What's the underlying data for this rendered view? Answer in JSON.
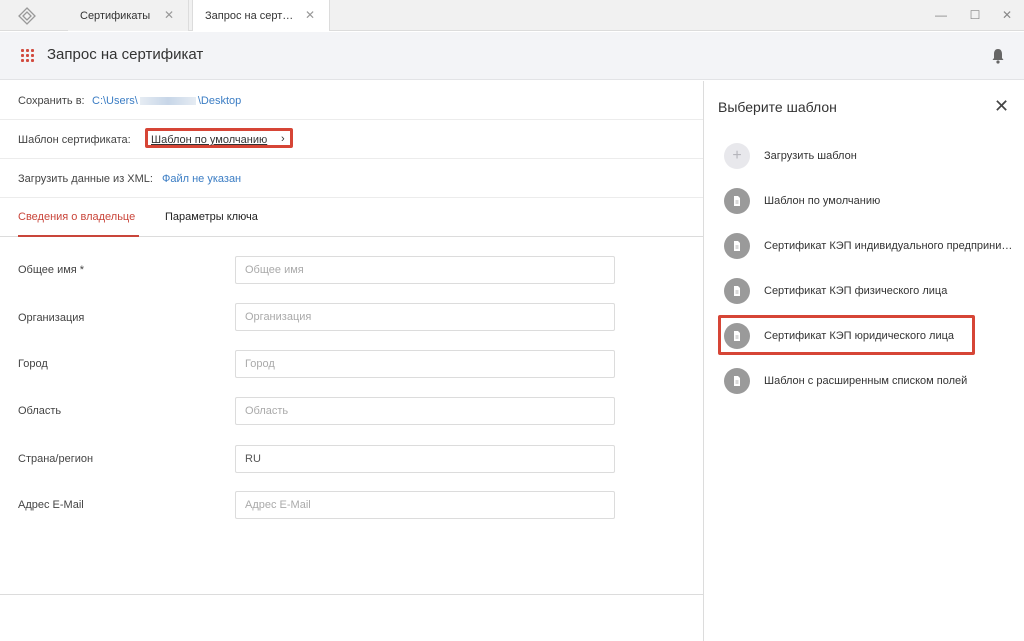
{
  "tabs": [
    {
      "label": "Сертификаты"
    },
    {
      "label": "Запрос на сертификат"
    }
  ],
  "header": {
    "title": "Запрос на сертификат"
  },
  "save_row": {
    "label": "Сохранить в:",
    "path_prefix": "C:\\Users\\",
    "path_suffix": "\\Desktop"
  },
  "template_row": {
    "label": "Шаблон сертификата:",
    "value": "Шаблон по умолчанию"
  },
  "xml_row": {
    "label": "Загрузить данные из XML:",
    "value": "Файл не указан"
  },
  "form_tabs": [
    {
      "label": "Сведения о владельце",
      "active": true
    },
    {
      "label": "Параметры ключа",
      "active": false
    }
  ],
  "fields": [
    {
      "label": "Общее имя *",
      "placeholder": "Общее имя",
      "value": ""
    },
    {
      "label": "Организация",
      "placeholder": "Организация",
      "value": ""
    },
    {
      "label": "Город",
      "placeholder": "Город",
      "value": ""
    },
    {
      "label": "Область",
      "placeholder": "Область",
      "value": ""
    },
    {
      "label": "Страна/регион",
      "placeholder": "",
      "value": "RU"
    },
    {
      "label": "Адрес E-Mail",
      "placeholder": "Адрес E-Mail",
      "value": ""
    }
  ],
  "panel": {
    "title": "Выберите шаблон",
    "items": [
      {
        "label": "Загрузить шаблон",
        "icon": "plus-icon"
      },
      {
        "label": "Шаблон по умолчанию",
        "icon": "document-icon"
      },
      {
        "label": "Сертификат КЭП индивидуального предпринимателя",
        "icon": "document-icon"
      },
      {
        "label": "Сертификат КЭП физического лица",
        "icon": "document-icon"
      },
      {
        "label": "Сертификат КЭП юридического лица",
        "icon": "document-icon",
        "highlighted": true
      },
      {
        "label": "Шаблон с расширенным списком полей",
        "icon": "document-icon"
      }
    ]
  },
  "colors": {
    "accent": "#c9453a",
    "link": "#3b7dc4",
    "highlight_border": "#d64536"
  }
}
